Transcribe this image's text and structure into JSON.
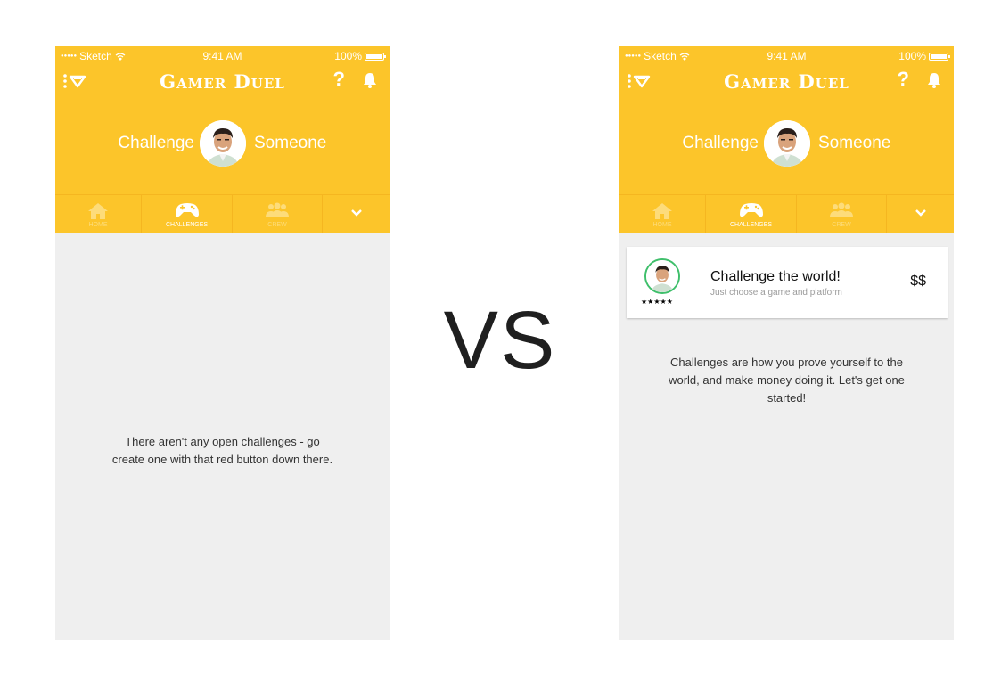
{
  "status_bar": {
    "carrier": "Sketch",
    "time": "9:41 AM",
    "battery": "100%"
  },
  "app": {
    "title": "Gamer Duel",
    "help_label": "?"
  },
  "hero": {
    "text_left": "Challenge",
    "text_right": "Someone"
  },
  "tabs": [
    {
      "label": "HOME",
      "icon": "home-icon"
    },
    {
      "label": "CHALLENGES",
      "icon": "gamepad-icon"
    },
    {
      "label": "CREW",
      "icon": "crew-icon"
    },
    {
      "label": "",
      "icon": "chevron-down-icon"
    }
  ],
  "left_screen": {
    "empty_message": "There aren't any open challenges - go create one with that red button down there."
  },
  "right_screen": {
    "card": {
      "title": "Challenge the world!",
      "subtitle": "Just choose a game and platform",
      "price": "$$",
      "rating": 5,
      "stars": "★★★★★"
    },
    "info_message": "Challenges are how you prove yourself to the world, and make money doing it. Let's get one started!"
  },
  "vs_label": "VS",
  "colors": {
    "brand": "#fcc52a",
    "background": "#efefef",
    "avatar_ring": "#3fbf6b"
  }
}
